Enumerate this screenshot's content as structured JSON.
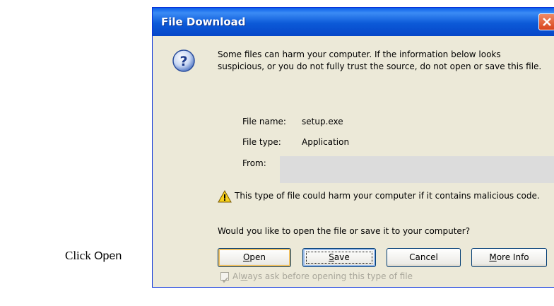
{
  "annotation": {
    "prefix": "Click",
    "target": "Open"
  },
  "dialog": {
    "title": "File Download",
    "warning_text": "Some files can harm your computer. If the information below looks suspicious, or you do not fully trust the source, do not open or save this file.",
    "file_info": {
      "name_label": "File name:",
      "name_value": "setup.exe",
      "type_label": "File type:",
      "type_value": "Application",
      "from_label": "From:"
    },
    "harm_text": "This type of file could harm your computer if it contains malicious code.",
    "question": "Would you like to open the file or save it to your computer?",
    "buttons": {
      "open": {
        "mnemonic": "O",
        "rest": "pen"
      },
      "save": {
        "mnemonic": "S",
        "rest": "ave"
      },
      "cancel": "Cancel",
      "more_info": {
        "mnemonic": "M",
        "rest": "ore Info"
      }
    },
    "checkbox": {
      "pre": "Al",
      "mnemonic": "w",
      "rest": "ays ask before opening this type of file",
      "checked": true,
      "disabled": true
    }
  },
  "colors": {
    "titlebar": "#0c5ad8",
    "dialog_bg": "#ece9d8",
    "close": "#d8441c"
  }
}
